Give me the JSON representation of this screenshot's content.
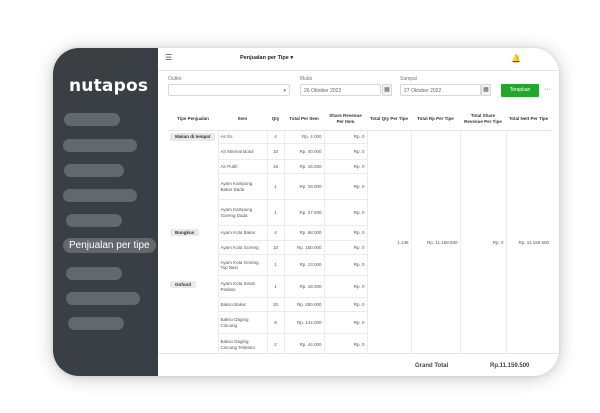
{
  "sidebar": {
    "logo": "nutapos",
    "active_item": "Penjualan per tipe"
  },
  "header": {
    "menu_icon": "hamburger-icon",
    "title": "Penjualan per Tipe ▾",
    "bell_icon": "bell-icon"
  },
  "filters": {
    "outlet_label": "Outlet",
    "outlet_value": "",
    "start_label": "Mulai",
    "start_value": "26 Oktober 2022",
    "end_label": "Sampai",
    "end_value": "27 Oktober 2022",
    "apply_label": "Terapkan",
    "more_label": "···",
    "apply_color": "#21a82b"
  },
  "table": {
    "headers": [
      "Tipe Penjualan",
      "Item",
      "Qty",
      "Total Per Item",
      "Share Revenue Per Item",
      "Total Qty Per Tipe",
      "Total Rp Per Tipe",
      "Total Share Revenue Per Tipe",
      "Total Nett Per Tipe"
    ],
    "rows": [
      {
        "type": "Makan di tempat",
        "item": "Air Es",
        "qty": "4",
        "total": "Rp. 4.000",
        "share": "Rp. 0",
        "tqty": "1.136",
        "trp": "Rp. 11.159.500",
        "tshare": "Rp. 0",
        "tnett": "Rp. 11.159.500"
      },
      {
        "type": "",
        "item": "Air Mineral Botol",
        "qty": "10",
        "total": "Rp. 40.000",
        "share": "Rp. 0"
      },
      {
        "type": "",
        "item": "Air Putih",
        "qty": "16",
        "total": "Rp. 16.000",
        "share": "Rp. 0"
      },
      {
        "type": "",
        "item": "Ayam Kampung Bakar Dada",
        "qty": "1",
        "total": "Rp. 29.000",
        "share": "Rp. 0"
      },
      {
        "type": "",
        "item": "Ayam Kampung Goreng Dada",
        "qty": "1",
        "total": "Rp. 27.000",
        "share": "Rp. 0"
      },
      {
        "type": "Bungkus",
        "item": "Ayam Kota Bakar",
        "qty": "4",
        "total": "Rp. 68.000",
        "share": "Rp. 0"
      },
      {
        "type": "",
        "item": "Ayam Kota Goreng",
        "qty": "10",
        "total": "Rp. 150.000",
        "share": "Rp. 0"
      },
      {
        "type": "",
        "item": "Ayam Kota Goreng Tsp Nasi",
        "qty": "1",
        "total": "Rp. 13.000",
        "share": "Rp. 0"
      },
      {
        "type": "Gofood",
        "item": "Ayam Kota Siram Pedass",
        "qty": "1",
        "total": "Rp. 18.000",
        "share": "Rp. 0"
      },
      {
        "type": "",
        "item": "Bakso Bakar",
        "qty": "20",
        "total": "Rp. 250.000",
        "share": "Rp. 0"
      },
      {
        "type": "",
        "item": "Bakso Daging Cincang",
        "qty": "9",
        "total": "Rp. 144.000",
        "share": "Rp. 0"
      },
      {
        "type": "",
        "item": "Bakso Daging Cincang Telelann",
        "qty": "2",
        "total": "Rp. 44.000",
        "share": "Rp. 0"
      }
    ]
  },
  "footer": {
    "grand_total_label": "Grand Total",
    "grand_total_value": "Rp.11.159.500"
  }
}
